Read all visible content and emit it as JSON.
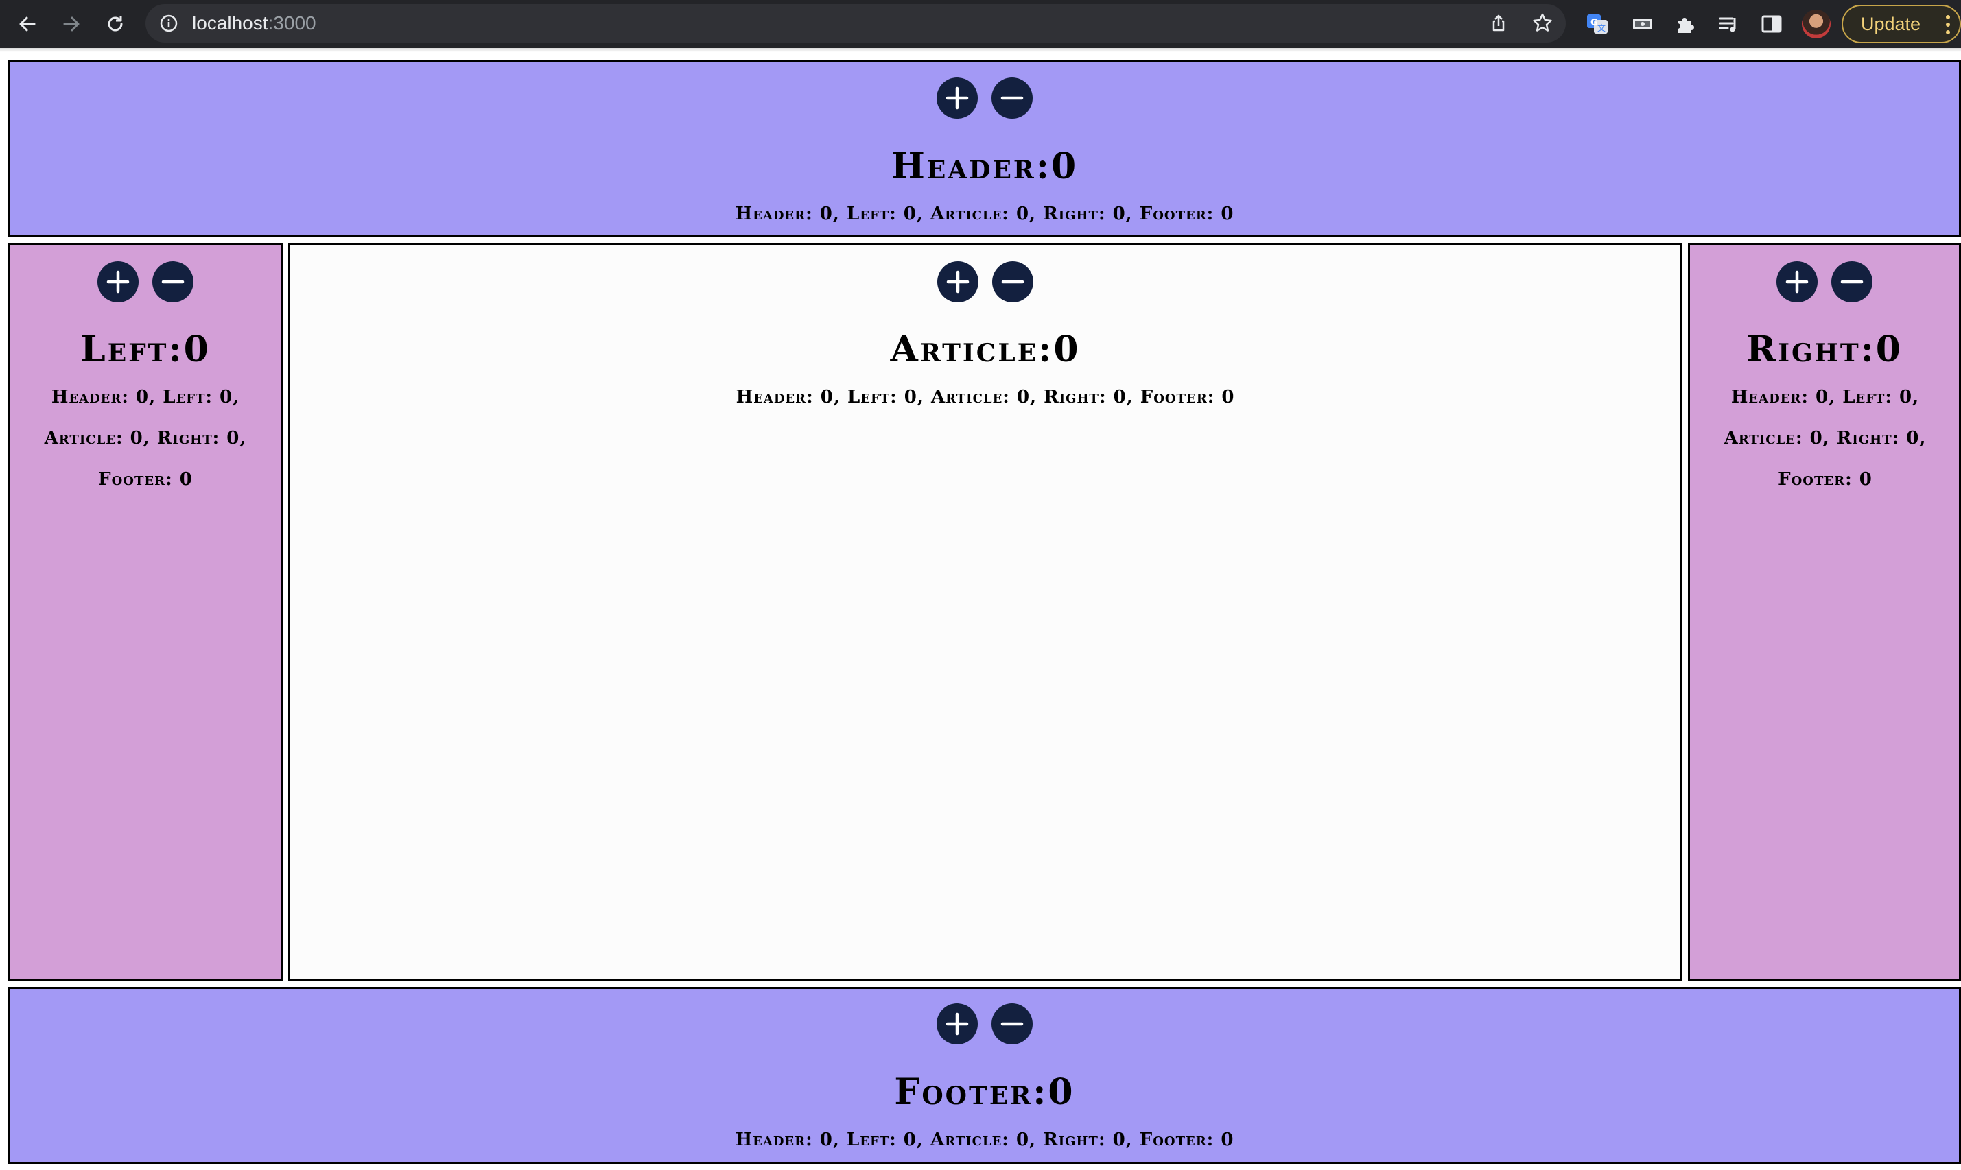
{
  "browser": {
    "url_host": "localhost",
    "url_port": ":3000",
    "update_label": "Update",
    "icons": [
      "back-icon",
      "forward-icon",
      "reload-icon",
      "site-info-icon",
      "share-icon",
      "bookmark-star-icon",
      "translate-extension-icon",
      "media-extension-icon",
      "extensions-puzzle-icon",
      "reading-list-icon",
      "side-panel-icon",
      "profile-avatar",
      "more-menu-icon"
    ]
  },
  "controls": {
    "plus_icon": "plus-icon",
    "minus_icon": "minus-icon",
    "button_color": "#13203f"
  },
  "colors": {
    "header_footer_bg": "#a399f5",
    "sidebar_bg": "#d39fd7",
    "article_bg": "#fcfcfc"
  },
  "sections": {
    "header": {
      "title": "Header:0",
      "counts": "Header: 0, Left: 0, Article: 0, Right: 0, Footer: 0"
    },
    "left": {
      "title": "Left:0",
      "counts": "Header: 0, Left: 0, Article: 0, Right: 0, Footer: 0"
    },
    "article": {
      "title": "Article:0",
      "counts": "Header: 0, Left: 0, Article: 0, Right: 0, Footer: 0"
    },
    "right": {
      "title": "Right:0",
      "counts": "Header: 0, Left: 0, Article: 0, Right: 0, Footer: 0"
    },
    "footer": {
      "title": "Footer:0",
      "counts": "Header: 0, Left: 0, Article: 0, Right: 0, Footer: 0"
    }
  }
}
